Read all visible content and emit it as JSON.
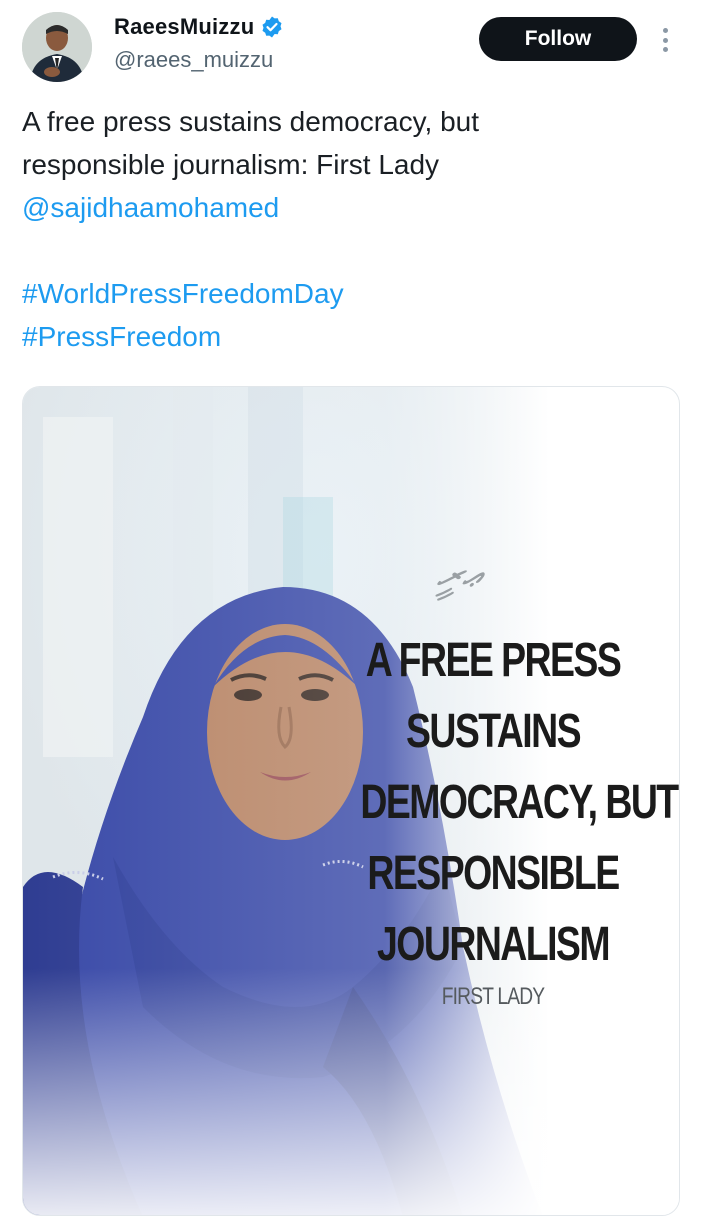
{
  "user": {
    "display_name": "RaeesMuizzu",
    "handle": "@raees_muizzu",
    "verified": true,
    "avatar_icon": "profile-photo-icon"
  },
  "actions": {
    "follow_label": "Follow",
    "more_icon": "more-vertical-icon"
  },
  "tweet": {
    "line1": "A free press sustains democracy, but",
    "line2": "responsible journalism: First Lady",
    "mention": "@sajidhaamohamed",
    "hashtags": [
      "#WorldPressFreedomDay",
      "#PressFreedom"
    ]
  },
  "media": {
    "script_mark": "ޢރީ",
    "headline_lines": [
      "A FREE PRESS",
      "SUSTAINS",
      "DEMOCRACY, BUT",
      "RESPONSIBLE",
      "JOURNALISM"
    ],
    "byline": "FIRST LADY"
  },
  "colors": {
    "link": "#1d9bf0",
    "follow_bg": "#0f1419",
    "verified": "#1d9bf0",
    "hijab": "#3a4aa8"
  }
}
